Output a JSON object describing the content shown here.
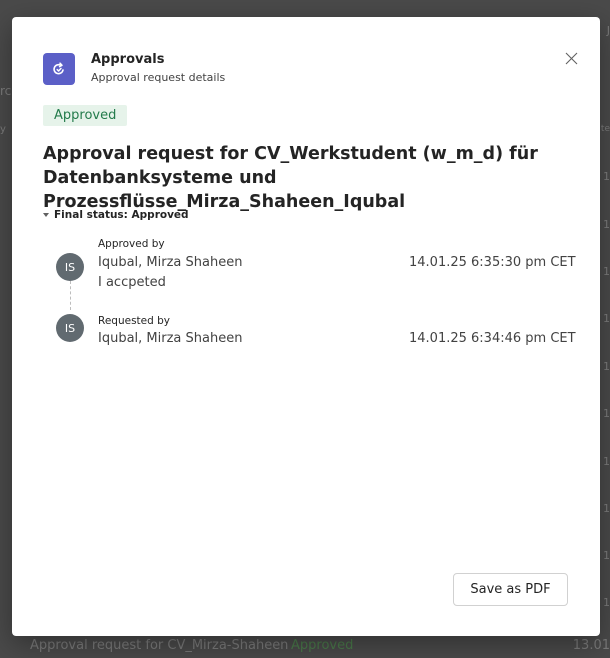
{
  "background": {
    "left_fragments": [
      "rc",
      "y"
    ],
    "right_fragments": [
      "J",
      "te",
      "1",
      "1",
      "1",
      "1",
      "1",
      "1",
      "1",
      "1",
      "1",
      "1"
    ],
    "footer_row": {
      "title": "Approval request for CV_Mirza-Shaheen",
      "status": "Approved",
      "date": "13.01"
    }
  },
  "dialog": {
    "app_name": "Approvals",
    "app_subtitle": "Approval request details",
    "status_badge": "Approved",
    "title": "Approval request for CV_Werkstudent (w_m_d) für Datenbanksysteme und Prozessflüsse_Mirza_Shaheen_Iqubal",
    "final_status_label": "Final status: Approved",
    "timeline": [
      {
        "avatar": "IS",
        "label": "Approved by",
        "name": "Iqubal, Mirza Shaheen",
        "time": "14.01.25 6:35:30 pm CET",
        "comment": "I accpeted"
      },
      {
        "avatar": "IS",
        "label": "Requested by",
        "name": "Iqubal, Mirza Shaheen",
        "time": "14.01.25 6:34:46 pm CET"
      }
    ],
    "save_pdf_label": "Save as PDF"
  },
  "colors": {
    "accent": "#5b5fc7",
    "approved_text": "#237b4b",
    "approved_bg": "#e6f3ea",
    "avatar_bg": "#616a70",
    "backdrop": "#4a4a4a"
  },
  "icons": {
    "app": "approvals-icon",
    "close": "close-icon",
    "expand": "caret-down-icon"
  }
}
